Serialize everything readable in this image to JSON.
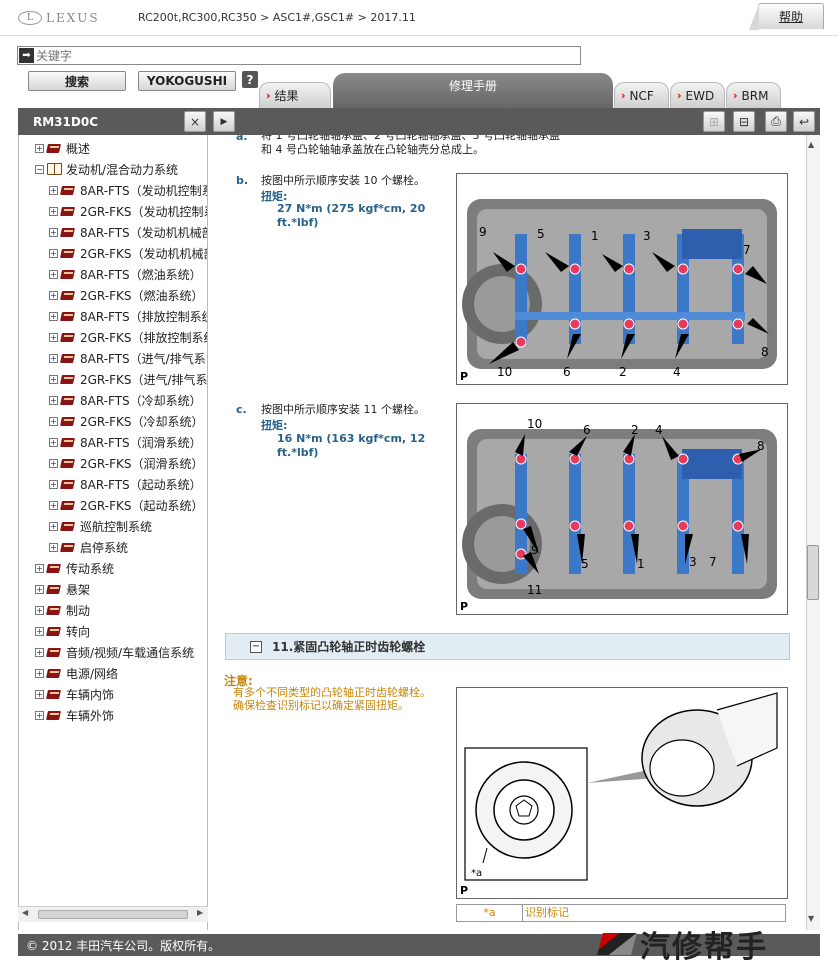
{
  "header": {
    "logo_text": "LEXUS",
    "breadcrumb": "RC200t,RC300,RC350 > ASC1#,GSC1# > 2017.11",
    "help_label": "帮助"
  },
  "search": {
    "placeholder": "关键字",
    "search_button": "搜索",
    "yokogushi_button": "YOKOGUSHI",
    "help_button": "?"
  },
  "tabs": {
    "results": "结果",
    "repair_manual": "修理手册",
    "ncf": "NCF",
    "ewd": "EWD",
    "brm": "BRM"
  },
  "sidebar": {
    "title": "RM31D0C",
    "close_button": "×",
    "next_button": "▶",
    "items": [
      {
        "label": "概述",
        "level": 0,
        "expander": "+",
        "icon": "book"
      },
      {
        "label": "发动机/混合动力系统",
        "level": 0,
        "expander": "−",
        "icon": "open-book"
      },
      {
        "label": "8AR-FTS（发动机控制系",
        "level": 1,
        "expander": "+",
        "icon": "book"
      },
      {
        "label": "2GR-FKS（发动机控制系",
        "level": 1,
        "expander": "+",
        "icon": "book"
      },
      {
        "label": "8AR-FTS（发动机机械部",
        "level": 1,
        "expander": "+",
        "icon": "book"
      },
      {
        "label": "2GR-FKS（发动机机械部",
        "level": 1,
        "expander": "+",
        "icon": "book"
      },
      {
        "label": "8AR-FTS（燃油系统）",
        "level": 1,
        "expander": "+",
        "icon": "book"
      },
      {
        "label": "2GR-FKS（燃油系统）",
        "level": 1,
        "expander": "+",
        "icon": "book"
      },
      {
        "label": "8AR-FTS（排放控制系统",
        "level": 1,
        "expander": "+",
        "icon": "book"
      },
      {
        "label": "2GR-FKS（排放控制系统",
        "level": 1,
        "expander": "+",
        "icon": "book"
      },
      {
        "label": "8AR-FTS（进气/排气系",
        "level": 1,
        "expander": "+",
        "icon": "book"
      },
      {
        "label": "2GR-FKS（进气/排气系",
        "level": 1,
        "expander": "+",
        "icon": "book"
      },
      {
        "label": "8AR-FTS（冷却系统）",
        "level": 1,
        "expander": "+",
        "icon": "book"
      },
      {
        "label": "2GR-FKS（冷却系统）",
        "level": 1,
        "expander": "+",
        "icon": "book"
      },
      {
        "label": "8AR-FTS（润滑系统）",
        "level": 1,
        "expander": "+",
        "icon": "book"
      },
      {
        "label": "2GR-FKS（润滑系统）",
        "level": 1,
        "expander": "+",
        "icon": "book"
      },
      {
        "label": "8AR-FTS（起动系统）",
        "level": 1,
        "expander": "+",
        "icon": "book"
      },
      {
        "label": "2GR-FKS（起动系统）",
        "level": 1,
        "expander": "+",
        "icon": "book"
      },
      {
        "label": "巡航控制系统",
        "level": 1,
        "expander": "+",
        "icon": "book"
      },
      {
        "label": "启停系统",
        "level": 1,
        "expander": "+",
        "icon": "book"
      },
      {
        "label": "传动系统",
        "level": 0,
        "expander": "+",
        "icon": "book"
      },
      {
        "label": "悬架",
        "level": 0,
        "expander": "+",
        "icon": "book"
      },
      {
        "label": "制动",
        "level": 0,
        "expander": "+",
        "icon": "book"
      },
      {
        "label": "转向",
        "level": 0,
        "expander": "+",
        "icon": "book"
      },
      {
        "label": "音频/视频/车载通信系统",
        "level": 0,
        "expander": "+",
        "icon": "book"
      },
      {
        "label": "电源/网络",
        "level": 0,
        "expander": "+",
        "icon": "book"
      },
      {
        "label": "车辆内饰",
        "level": 0,
        "expander": "+",
        "icon": "book"
      },
      {
        "label": "车辆外饰",
        "level": 0,
        "expander": "+",
        "icon": "book"
      }
    ]
  },
  "content": {
    "step_a_letter": "a.",
    "step_a_text": "将 1 号凸轮轴轴承盖、2 号凸轮轴轴承盖、3 号凸轮轴轴承盖和 4 号凸轮轴轴承盖放在凸轮轴壳分总成上。",
    "step_b_letter": "b.",
    "step_b_text": "按图中所示顺序安装 10 个螺栓。",
    "torque_label": "扭矩:",
    "step_b_torque": "27 N*m (275 kgf*cm, 20 ft.*lbf)",
    "step_c_letter": "c.",
    "step_c_text": "按图中所示顺序安装 11 个螺栓。",
    "step_c_torque": "16 N*m (163 kgf*cm, 12 ft.*lbf)",
    "fig1_labels": [
      "9",
      "5",
      "1",
      "3",
      "7",
      "10",
      "6",
      "2",
      "4",
      "8"
    ],
    "fig2_labels": [
      "10",
      "6",
      "2",
      "4",
      "8",
      "9",
      "11",
      "5",
      "1",
      "3",
      "7"
    ],
    "fig_corner": "P",
    "section_title": "11.紧固凸轮轴正时齿轮螺栓",
    "note_head": "注意:",
    "note_text": "有多个不同类型的凸轮轴正时齿轮螺栓。确保检查识别标记以确定紧固扭矩。",
    "fig3_callout": "*a",
    "legend_key": "*a",
    "legend_value": "识别标记"
  },
  "toolbar_icons": [
    "expand-all-icon",
    "collapse-all-icon",
    "print-icon",
    "back-icon"
  ],
  "footer": {
    "copyright": "© 2012 丰田汽车公司。版权所有。",
    "brand": "汽修帮手"
  },
  "colors": {
    "dark_bar": "#5a5a5a",
    "accent_blue": "#27628a",
    "note_orange": "#c8860b",
    "tab_arrow": "#cc0000"
  }
}
